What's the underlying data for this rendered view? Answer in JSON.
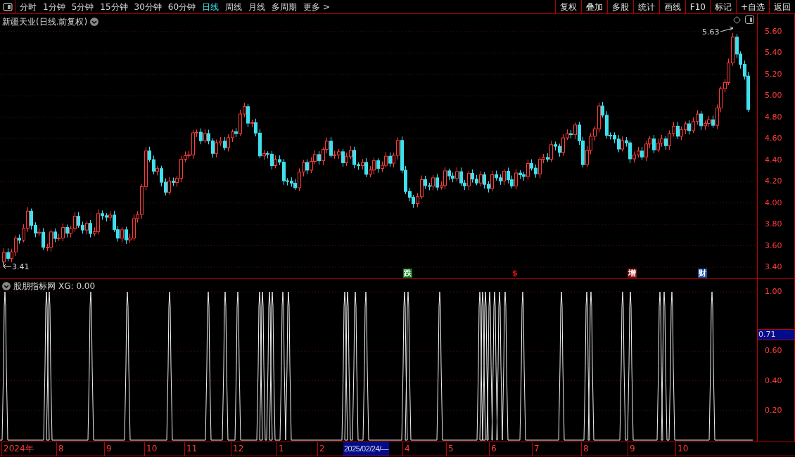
{
  "periods": [
    {
      "label": "分时",
      "selected": false
    },
    {
      "label": "1分钟",
      "selected": false
    },
    {
      "label": "5分钟",
      "selected": false
    },
    {
      "label": "15分钟",
      "selected": false
    },
    {
      "label": "30分钟",
      "selected": false
    },
    {
      "label": "60分钟",
      "selected": false
    },
    {
      "label": "日线",
      "selected": true
    },
    {
      "label": "周线",
      "selected": false
    },
    {
      "label": "月线",
      "selected": false
    },
    {
      "label": "多周期",
      "selected": false
    },
    {
      "label": "更多 >",
      "selected": false
    }
  ],
  "toolbar_buttons": [
    "复权",
    "叠加",
    "多股",
    "统计",
    "画线",
    "F10",
    "标记",
    "+自选",
    "返回"
  ],
  "main_chart": {
    "title": "新疆天业(日线.前复权)",
    "high_label": "5.63",
    "low_label": "3.41",
    "y_ticks": [
      "5.60",
      "5.40",
      "5.20",
      "5.00",
      "4.80",
      "4.60",
      "4.40",
      "4.20",
      "4.00",
      "3.80",
      "3.60",
      "3.40"
    ],
    "event_marks": [
      {
        "text": "跌",
        "color": "#0f7a1e"
      },
      {
        "text": "$",
        "color": "#e01010"
      },
      {
        "text": "增",
        "color": "#8a0e0e"
      },
      {
        "text": "财",
        "color": "#1c4f9c"
      }
    ]
  },
  "indicator": {
    "title": "股朋指标网",
    "value": "XG: 0.00",
    "y_ticks": [
      "1.00",
      "0.60",
      "0.40",
      "0.20"
    ],
    "current_value": "0.71"
  },
  "date_axis": [
    "2024年",
    "8",
    "9",
    "10",
    "11",
    "12",
    "1",
    "2",
    "2025/02/24/—",
    "4",
    "5",
    "6",
    "7",
    "8",
    "9",
    "10"
  ]
}
